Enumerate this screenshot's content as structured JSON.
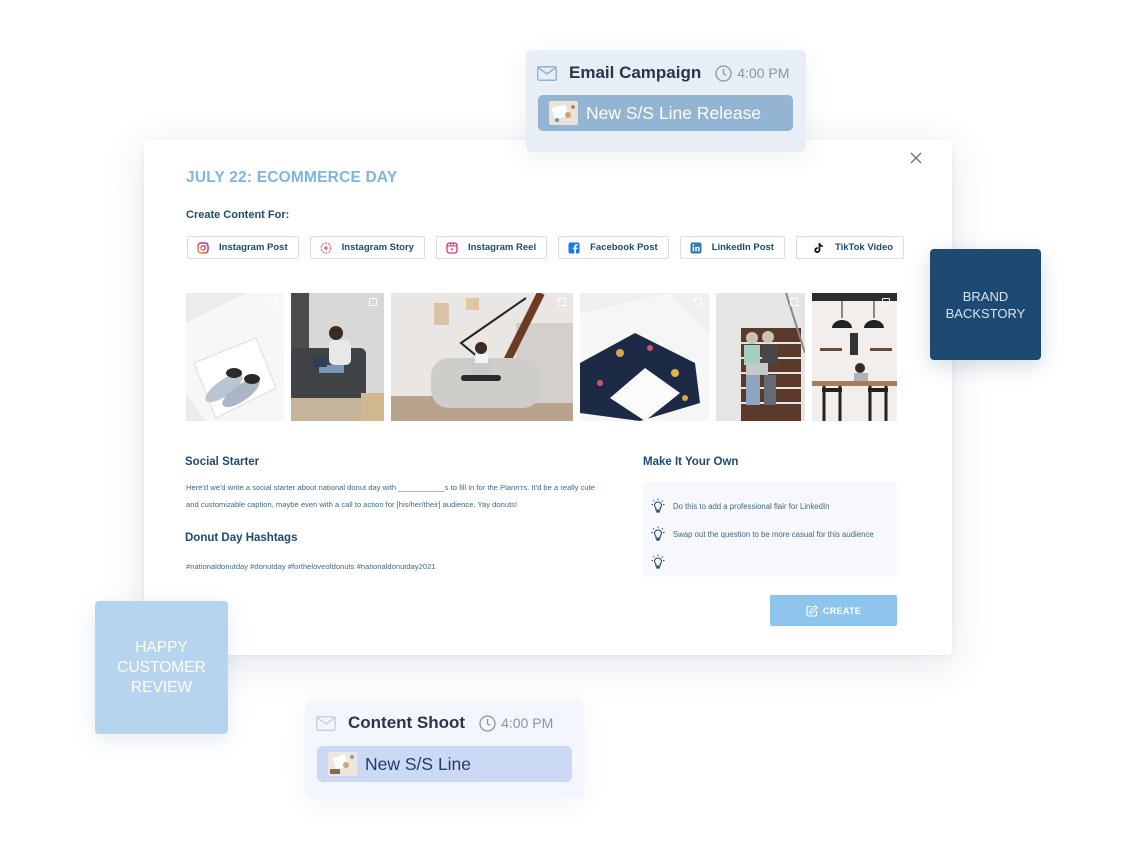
{
  "email_event": {
    "icon": "mail-icon",
    "title": "Email Campaign",
    "time": "4:00 PM",
    "pill_label": "New S/S Line Release",
    "pill_color": "#93b4d2"
  },
  "modal": {
    "title": "JULY 22: ECOMMERCE DAY",
    "title_color": "#7cb6e2",
    "create_for_label": "Create Content For:",
    "platforms": [
      {
        "label": "Instagram Post",
        "icon": "instagram-icon"
      },
      {
        "label": "Instagram Story",
        "icon": "instagram-story-icon"
      },
      {
        "label": "Instagram Reel",
        "icon": "instagram-reel-icon"
      },
      {
        "label": "Facebook Post",
        "icon": "facebook-icon"
      },
      {
        "label": "LinkedIn Post",
        "icon": "linkedin-icon"
      },
      {
        "label": "TikTok Video",
        "icon": "tiktok-icon"
      }
    ],
    "photos": [
      {
        "subject": "shoes in white box"
      },
      {
        "subject": "man on sofa with laptop"
      },
      {
        "subject": "woman on sofa with laptop"
      },
      {
        "subject": "floral fabric with blank card"
      },
      {
        "subject": "two people on stairs with laptop"
      },
      {
        "subject": "kitchen with person at laptop"
      }
    ],
    "social_starter": {
      "title": "Social Starter",
      "text": "Here'd we'd write a social starter about national donut day with ___________s to fill in for the Plann'rs. It'd be a really cute and customizable caption, maybe even with a call to action for [his/her/their] audience. Yay donuts!"
    },
    "hashtags": {
      "title": "Donut Day Hashtags",
      "text": "#nationaldonutday #donutday #fortheloveofdonuts #nationaldonutday2021"
    },
    "make_it_your_own": {
      "title": "Make It Your Own",
      "tips": [
        "Do this to add a professional flair for LinkedIn",
        "Swap out the question to be more casual for this audience",
        ""
      ]
    },
    "create_button": "CREATE",
    "create_color": "#8ec5ec"
  },
  "notes": {
    "brand": "BRAND BACKSTORY",
    "brand_color": "#1e4a72",
    "happy": "HAPPY CUSTOMER REVIEW",
    "happy_color": "#b7d4ee"
  },
  "shoot_event": {
    "icon": "mail-icon",
    "title": "Content Shoot",
    "time": "4:00 PM",
    "pill_label": "New S/S Line",
    "pill_color": "#ccd9f4"
  }
}
